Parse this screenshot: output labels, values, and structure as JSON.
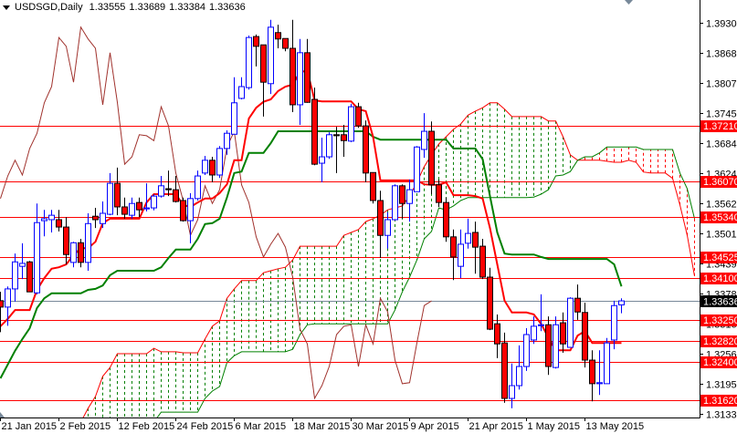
{
  "header": {
    "symbol_timeframe": "USDSGD,Daily",
    "open": "1.33555",
    "high": "1.33689",
    "low": "1.33384",
    "close": "1.33636"
  },
  "chart_data": {
    "type": "candlestick",
    "title": "USDSGD,Daily",
    "ylim": [
      1.31261,
      1.39764
    ],
    "bar_spacing_note": "one candle per trading day",
    "colors": {
      "bull": "#0000ff",
      "bear_fill": "#ff0000",
      "bear_outline": "#000000",
      "tenkan": "#ff0000",
      "kijun": "#008000",
      "chikou": "#a0322d",
      "span_a": "#ff0000",
      "span_b": "#008000",
      "level": "#ff0000",
      "current": "#778899"
    },
    "x_tick_labels": [
      {
        "bar": 0,
        "label": "21 Jan 2015"
      },
      {
        "bar": 8,
        "label": "2 Feb 2015"
      },
      {
        "bar": 16,
        "label": "12 Feb 2015"
      },
      {
        "bar": 24,
        "label": "24 Feb 2015"
      },
      {
        "bar": 32,
        "label": "6 Mar 2015"
      },
      {
        "bar": 40,
        "label": "18 Mar 2015"
      },
      {
        "bar": 48,
        "label": "30 Mar 2015"
      },
      {
        "bar": 56,
        "label": "9 Apr 2015"
      },
      {
        "bar": 64,
        "label": "21 Apr 2015"
      },
      {
        "bar": 72,
        "label": "1 May 2015"
      },
      {
        "bar": 80,
        "label": "13 May 2015"
      }
    ],
    "y_tick_labels": [
      "1.39300",
      "1.38685",
      "1.38070",
      "1.37455",
      "1.36840",
      "1.36240",
      "1.35625",
      "1.35010",
      "1.34395",
      "1.33780",
      "1.33165",
      "1.32565",
      "1.31950",
      "1.31335"
    ],
    "levels": [
      "1.37210",
      "1.36070",
      "1.35340",
      "1.34525",
      "1.34100",
      "1.33250",
      "1.32820",
      "1.32400",
      "1.31620"
    ],
    "current_price": "1.33636",
    "candles": [
      [
        1.3364,
        1.3382,
        1.33,
        1.3351
      ],
      [
        1.3351,
        1.3393,
        1.3313,
        1.3388
      ],
      [
        1.3388,
        1.346,
        1.3362,
        1.3443
      ],
      [
        1.3434,
        1.3481,
        1.3408,
        1.344
      ],
      [
        1.3443,
        1.3445,
        1.3382,
        1.3382
      ],
      [
        1.338,
        1.3562,
        1.3377,
        1.3523
      ],
      [
        1.3527,
        1.3549,
        1.3495,
        1.3531
      ],
      [
        1.3529,
        1.3549,
        1.3503,
        1.3538
      ],
      [
        1.3529,
        1.3549,
        1.3505,
        1.3514
      ],
      [
        1.3514,
        1.3534,
        1.3438,
        1.3458
      ],
      [
        1.3442,
        1.3484,
        1.3432,
        1.3482
      ],
      [
        1.3482,
        1.349,
        1.3432,
        1.3442
      ],
      [
        1.3442,
        1.3542,
        1.3425,
        1.3521
      ],
      [
        1.3536,
        1.3553,
        1.3512,
        1.3529
      ],
      [
        1.3521,
        1.3566,
        1.3512,
        1.3542
      ],
      [
        1.354,
        1.3624,
        1.3538,
        1.3603
      ],
      [
        1.3603,
        1.3635,
        1.3538,
        1.3555
      ],
      [
        1.3555,
        1.3574,
        1.3531,
        1.354
      ],
      [
        1.3538,
        1.3574,
        1.3531,
        1.3562
      ],
      [
        1.3564,
        1.3574,
        1.3534,
        1.3549
      ],
      [
        1.3551,
        1.3603,
        1.3546,
        1.3553
      ],
      [
        1.3553,
        1.3581,
        1.3548,
        1.3577
      ],
      [
        1.3577,
        1.3618,
        1.3574,
        1.3598
      ],
      [
        1.3592,
        1.3629,
        1.3577,
        1.359
      ],
      [
        1.359,
        1.3618,
        1.3564,
        1.3566
      ],
      [
        1.3568,
        1.3574,
        1.3525,
        1.3527
      ],
      [
        1.3527,
        1.3583,
        1.3481,
        1.3572
      ],
      [
        1.3572,
        1.3629,
        1.3568,
        1.3618
      ],
      [
        1.3624,
        1.3659,
        1.362,
        1.365
      ],
      [
        1.365,
        1.3657,
        1.3605,
        1.362
      ],
      [
        1.362,
        1.3679,
        1.3614,
        1.3674
      ],
      [
        1.3674,
        1.3711,
        1.3661,
        1.3705
      ],
      [
        1.3703,
        1.3819,
        1.3703,
        1.3767
      ],
      [
        1.3776,
        1.3819,
        1.3774,
        1.38
      ],
      [
        1.3798,
        1.3904,
        1.3794,
        1.39
      ],
      [
        1.3902,
        1.3906,
        1.3841,
        1.3882
      ],
      [
        1.3885,
        1.3885,
        1.3739,
        1.3809
      ],
      [
        1.3806,
        1.3936,
        1.3785,
        1.3921
      ],
      [
        1.391,
        1.3926,
        1.3878,
        1.3897
      ],
      [
        1.3898,
        1.3898,
        1.3872,
        1.3878
      ],
      [
        1.3878,
        1.3936,
        1.3748,
        1.3763
      ],
      [
        1.3763,
        1.3897,
        1.3722,
        1.3869
      ],
      [
        1.3869,
        1.3897,
        1.3767,
        1.3768
      ],
      [
        1.3774,
        1.3798,
        1.364,
        1.3642
      ],
      [
        1.3644,
        1.3696,
        1.3605,
        1.3657
      ],
      [
        1.3657,
        1.3707,
        1.3653,
        1.3702
      ],
      [
        1.3702,
        1.3718,
        1.3624,
        1.37
      ],
      [
        1.3702,
        1.3722,
        1.3657,
        1.369
      ],
      [
        1.3689,
        1.3765,
        1.3687,
        1.3759
      ],
      [
        1.3759,
        1.3767,
        1.3716,
        1.372
      ],
      [
        1.372,
        1.3731,
        1.3605,
        1.3624
      ],
      [
        1.3625,
        1.3625,
        1.3562,
        1.3568
      ],
      [
        1.3568,
        1.3588,
        1.3451,
        1.3497
      ],
      [
        1.3497,
        1.3544,
        1.347,
        1.3529
      ],
      [
        1.3529,
        1.3601,
        1.3527,
        1.3598
      ],
      [
        1.3598,
        1.3601,
        1.3531,
        1.3562
      ],
      [
        1.3562,
        1.3611,
        1.3525,
        1.359
      ],
      [
        1.3586,
        1.3679,
        1.3586,
        1.3677
      ],
      [
        1.3672,
        1.3746,
        1.3655,
        1.3709
      ],
      [
        1.3709,
        1.3729,
        1.3581,
        1.36
      ],
      [
        1.36,
        1.3611,
        1.3555,
        1.3564
      ],
      [
        1.3564,
        1.3574,
        1.3484,
        1.3494
      ],
      [
        1.3494,
        1.3509,
        1.3406,
        1.3453
      ],
      [
        1.3434,
        1.3509,
        1.341,
        1.3479
      ],
      [
        1.3481,
        1.3531,
        1.347,
        1.3501
      ],
      [
        1.3503,
        1.3525,
        1.3419,
        1.3473
      ],
      [
        1.3475,
        1.349,
        1.3408,
        1.3412
      ],
      [
        1.3412,
        1.3431,
        1.3304,
        1.3306
      ],
      [
        1.3317,
        1.3336,
        1.3247,
        1.3276
      ],
      [
        1.3278,
        1.3299,
        1.3156,
        1.3165
      ],
      [
        1.3165,
        1.3236,
        1.3145,
        1.3191
      ],
      [
        1.3191,
        1.3273,
        1.3183,
        1.323
      ],
      [
        1.323,
        1.3308,
        1.3221,
        1.3295
      ],
      [
        1.3284,
        1.3332,
        1.3276,
        1.3312
      ],
      [
        1.3313,
        1.3377,
        1.3302,
        1.3315
      ],
      [
        1.3315,
        1.3332,
        1.3213,
        1.323
      ],
      [
        1.3228,
        1.3332,
        1.3226,
        1.3315
      ],
      [
        1.3319,
        1.334,
        1.3258,
        1.3276
      ],
      [
        1.3269,
        1.3371,
        1.3269,
        1.3369
      ],
      [
        1.3369,
        1.3397,
        1.3325,
        1.3341
      ],
      [
        1.334,
        1.336,
        1.3228,
        1.3243
      ],
      [
        1.3243,
        1.3263,
        1.3159,
        1.3195
      ],
      [
        1.3195,
        1.3263,
        1.3172,
        1.3197
      ],
      [
        1.3195,
        1.3288,
        1.3195,
        1.3278
      ],
      [
        1.3284,
        1.3364,
        1.3265,
        1.3354
      ],
      [
        1.33555,
        1.33689,
        1.33384,
        1.33636
      ]
    ],
    "tenkan": [
      1.3312,
      1.3327,
      1.3345,
      1.3345,
      1.3345,
      1.3386,
      1.341,
      1.3429,
      1.3432,
      1.3438,
      1.3457,
      1.3471,
      1.3471,
      1.3484,
      1.3522,
      1.3531,
      1.3531,
      1.3531,
      1.3531,
      1.3531,
      1.3564,
      1.3581,
      1.3581,
      1.3581,
      1.3581,
      1.3559,
      1.3555,
      1.3564,
      1.3572,
      1.3572,
      1.3583,
      1.3601,
      1.365,
      1.365,
      1.3735,
      1.3757,
      1.3769,
      1.3774,
      1.3791,
      1.38,
      1.3804,
      1.383,
      1.3832,
      1.3772,
      1.377,
      1.377,
      1.377,
      1.377,
      1.377,
      1.3754,
      1.375,
      1.3698,
      1.3609,
      1.3609,
      1.3609,
      1.3609,
      1.3609,
      1.3609,
      1.3601,
      1.36,
      1.36,
      1.3605,
      1.3579,
      1.3579,
      1.3579,
      1.3577,
      1.3572,
      1.3512,
      1.3438,
      1.3364,
      1.334,
      1.334,
      1.334,
      1.3336,
      1.3317,
      1.3289,
      1.3263,
      1.3263,
      1.3263,
      1.3293,
      1.3302,
      1.3278,
      1.3278,
      1.3278,
      1.3278,
      1.3278
    ],
    "kijun": [
      1.3206,
      1.3234,
      1.3262,
      1.3286,
      1.3308,
      1.3349,
      1.3369,
      1.3379,
      1.3379,
      1.3379,
      1.3379,
      1.3379,
      1.3386,
      1.3388,
      1.3395,
      1.3416,
      1.3425,
      1.3425,
      1.3425,
      1.3425,
      1.3425,
      1.3425,
      1.3432,
      1.3451,
      1.3468,
      1.3468,
      1.3468,
      1.349,
      1.352,
      1.3522,
      1.3531,
      1.3574,
      1.3624,
      1.3627,
      1.3665,
      1.3665,
      1.3665,
      1.3685,
      1.3709,
      1.3709,
      1.3709,
      1.3709,
      1.3709,
      1.3709,
      1.3709,
      1.3709,
      1.3709,
      1.3709,
      1.3709,
      1.3709,
      1.3709,
      1.3698,
      1.3692,
      1.3692,
      1.3692,
      1.3692,
      1.3692,
      1.3692,
      1.3692,
      1.3692,
      1.3692,
      1.3692,
      1.3674,
      1.3674,
      1.3674,
      1.3674,
      1.3652,
      1.3577,
      1.3503,
      1.346,
      1.3458,
      1.3458,
      1.3458,
      1.3458,
      1.3453,
      1.3449,
      1.3449,
      1.3449,
      1.3449,
      1.3449,
      1.3449,
      1.3449,
      1.3449,
      1.3449,
      1.3438,
      1.3393
    ],
    "senkou_a": {
      "start_bar": 11,
      "values": [
        1.3113,
        1.3145,
        1.3169,
        1.321,
        1.3228,
        1.3256,
        1.3256,
        1.3256,
        1.3256,
        1.3256,
        1.3267,
        1.326,
        1.326,
        1.326,
        1.3258,
        1.3258,
        1.3258,
        1.3286,
        1.3312,
        1.3323,
        1.3369,
        1.3388,
        1.3405,
        1.3405,
        1.3405,
        1.3421,
        1.3425,
        1.3429,
        1.3432,
        1.3447,
        1.3475,
        1.3475,
        1.3475,
        1.3475,
        1.3475,
        1.3475,
        1.3497,
        1.3503,
        1.3509,
        1.3525,
        1.3531,
        1.3538,
        1.3549,
        1.3553,
        1.3557,
        1.3577,
        1.3605,
        1.3637,
        1.3661,
        1.3683,
        1.3698,
        1.3713,
        1.3724,
        1.3742,
        1.375,
        1.3757,
        1.3767,
        1.3767,
        1.3754,
        1.3739,
        1.3739,
        1.3739,
        1.3739,
        1.3739,
        1.373,
        1.373,
        1.3698,
        1.3661,
        1.365,
        1.365,
        1.365,
        1.365,
        1.3648,
        1.3646,
        1.3646,
        1.365,
        1.3646,
        1.3626,
        1.3624,
        1.3624,
        1.3624,
        1.3613,
        1.3559,
        1.3497,
        1.3414
      ]
    },
    "senkou_b": {
      "start_bar": 11,
      "values": [
        1.3085,
        1.3104,
        1.3104,
        1.3104,
        1.3104,
        1.3104,
        1.3104,
        1.3104,
        1.3104,
        1.3104,
        1.3104,
        1.3137,
        1.3137,
        1.3137,
        1.3137,
        1.3137,
        1.3137,
        1.3165,
        1.318,
        1.3189,
        1.3238,
        1.3252,
        1.326,
        1.326,
        1.326,
        1.326,
        1.326,
        1.326,
        1.326,
        1.3265,
        1.3295,
        1.3315,
        1.3317,
        1.3317,
        1.3317,
        1.3317,
        1.3317,
        1.3317,
        1.3317,
        1.3317,
        1.3317,
        1.3317,
        1.3317,
        1.3345,
        1.3382,
        1.3412,
        1.3447,
        1.349,
        1.3505,
        1.3553,
        1.3549,
        1.3557,
        1.3568,
        1.3574,
        1.3574,
        1.3574,
        1.3574,
        1.3574,
        1.3574,
        1.3574,
        1.3574,
        1.3574,
        1.3575,
        1.3581,
        1.359,
        1.3618,
        1.362,
        1.3627,
        1.365,
        1.3657,
        1.3657,
        1.3665,
        1.3677,
        1.3677,
        1.3677,
        1.3677,
        1.3677,
        1.3672,
        1.3672,
        1.3672,
        1.3672,
        1.3672,
        1.3624,
        1.3592,
        1.3531
      ]
    },
    "chikou_shift": 26
  }
}
